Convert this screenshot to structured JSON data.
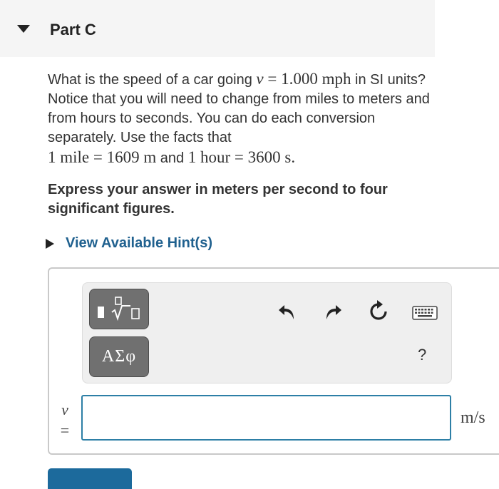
{
  "part": {
    "title": "Part C",
    "collapse_icon": "triangle-down-icon"
  },
  "question": {
    "text_1": "What is the speed of a car going ",
    "var": "v",
    "eq": " = ",
    "value": "1.000 mph",
    "text_2": " in SI units? Notice that you will need to change from miles to meters and from hours to seconds. You can do each conversion separately. Use the facts that",
    "fact_1": "1 mile = 1609 m",
    "text_3": " and ",
    "fact_2": "1 hour = 3600 s",
    "end": "."
  },
  "instruction": "Express your answer in meters per second to four significant figures.",
  "hint": {
    "label": "View Available Hint(s)",
    "icon": "triangle-right-icon"
  },
  "toolbar": {
    "templates_icon": "templates-icon",
    "symbols_label": "ΑΣφ",
    "undo_icon": "undo-icon",
    "redo_icon": "redo-icon",
    "reset_icon": "reset-icon",
    "keyboard_icon": "keyboard-icon",
    "help_label": "?"
  },
  "answer": {
    "variable": "v",
    "equals": "=",
    "value": "",
    "unit": "m/s"
  },
  "colors": {
    "header_bg": "#f5f5f5",
    "link": "#20618f",
    "input_border": "#2d7fa6",
    "button_gray": "#707070",
    "submit": "#1c6a9c"
  }
}
